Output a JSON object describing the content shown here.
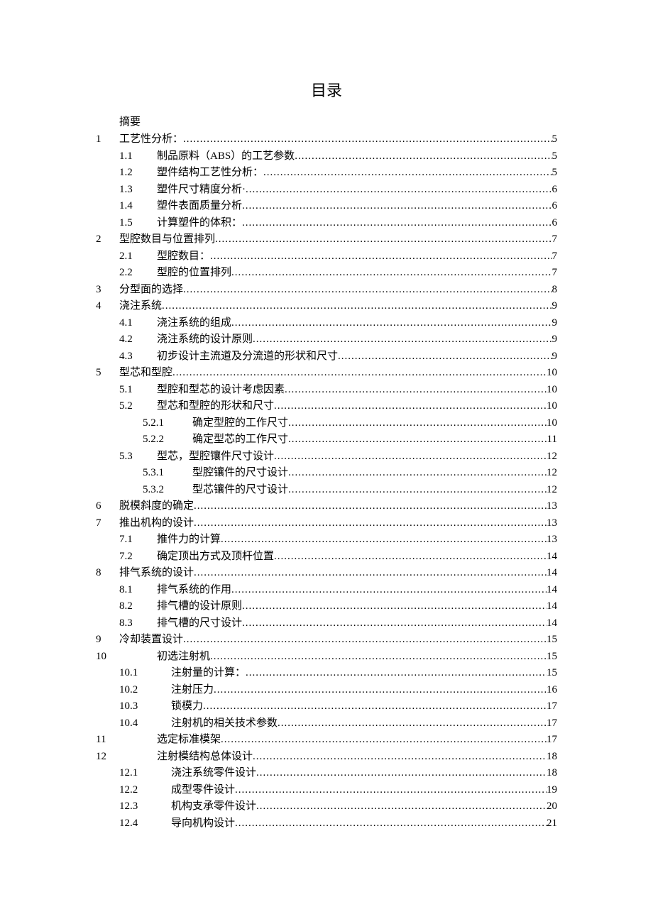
{
  "title": "目录",
  "abstract": "摘要",
  "entries": [
    {
      "level": 1,
      "num": "1",
      "text": "工艺性分析：",
      "page": "5"
    },
    {
      "level": 2,
      "num": "1.1",
      "text": "制品原料（ABS）的工艺参数",
      "page": "5"
    },
    {
      "level": 2,
      "num": "1.2",
      "text": "塑件结构工艺性分析：",
      "page": "5"
    },
    {
      "level": 2,
      "num": "1.3",
      "text": "塑件尺寸精度分析·",
      "page": "6"
    },
    {
      "level": 2,
      "num": "1.4",
      "text": "塑件表面质量分析",
      "page": "6"
    },
    {
      "level": 2,
      "num": "1.5",
      "text": "计算塑件的体积：",
      "page": "6"
    },
    {
      "level": 1,
      "num": "2",
      "text": "型腔数目与位置排列",
      "page": "7"
    },
    {
      "level": 2,
      "num": "2.1",
      "text": "型腔数目：",
      "page": "7"
    },
    {
      "level": 2,
      "num": "2.2",
      "text": "型腔的位置排列",
      "page": "7"
    },
    {
      "level": 1,
      "num": "3",
      "text": "分型面的选择",
      "page": "8"
    },
    {
      "level": 1,
      "num": "4",
      "text": "浇注系统",
      "page": "9"
    },
    {
      "level": 2,
      "num": "4.1",
      "text": "浇注系统的组成",
      "page": "9"
    },
    {
      "level": 2,
      "num": "4.2",
      "text": "浇注系统的设计原则",
      "page": "9"
    },
    {
      "level": 2,
      "num": "4.3",
      "text": "初步设计主流道及分流道的形状和尺寸",
      "page": "9"
    },
    {
      "level": 1,
      "num": "5",
      "text": "型芯和型腔",
      "page": "10"
    },
    {
      "level": 2,
      "num": "5.1",
      "text": "型腔和型芯的设计考虑因素",
      "page": "10"
    },
    {
      "level": 2,
      "num": "5.2",
      "text": "型芯和型腔的形状和尺寸",
      "page": "10"
    },
    {
      "level": 3,
      "num": "5.2.1",
      "text": "确定型腔的工作尺寸",
      "page": "10"
    },
    {
      "level": 3,
      "num": "5.2.2",
      "text": "确定型芯的工作尺寸",
      "page": "11"
    },
    {
      "level": 2,
      "num": "5.3",
      "text": "型芯，型腔镶件尺寸设计",
      "page": "12"
    },
    {
      "level": 3,
      "num": "5.3.1",
      "text": "型腔镶件的尺寸设计",
      "page": "12"
    },
    {
      "level": 3,
      "num": "5.3.2",
      "text": "型芯镶件的尺寸设计",
      "page": "12"
    },
    {
      "level": 1,
      "num": "6",
      "text": "脱模斜度的确定",
      "page": "13"
    },
    {
      "level": 1,
      "num": "7",
      "text": "推出机构的设计",
      "page": "13"
    },
    {
      "level": 2,
      "num": "7.1",
      "text": "推件力的计算",
      "page": "13"
    },
    {
      "level": 2,
      "num": "7.2",
      "text": "确定顶出方式及顶杆位置",
      "page": "14"
    },
    {
      "level": 1,
      "num": "8",
      "text": "排气系统的设计",
      "page": "14"
    },
    {
      "level": 2,
      "num": "8.1",
      "text": "排气系统的作用",
      "page": "14"
    },
    {
      "level": 2,
      "num": "8.2",
      "text": "排气槽的设计原则",
      "page": "14"
    },
    {
      "level": 2,
      "num": "8.3",
      "text": "排气槽的尺寸设计",
      "page": "14"
    },
    {
      "level": 1,
      "num": "9",
      "text": "冷却装置设计",
      "page": "15"
    },
    {
      "level": 1,
      "num": "10",
      "text": "初选注射机",
      "page": "15",
      "wide": true
    },
    {
      "level": 2,
      "num": "10.1",
      "text": "注射量的计算：",
      "page": "15",
      "wide": true
    },
    {
      "level": 2,
      "num": "10.2",
      "text": "注射压力",
      "page": "16",
      "wide": true
    },
    {
      "level": 2,
      "num": "10.3",
      "text": "锁模力",
      "page": "17",
      "wide": true
    },
    {
      "level": 2,
      "num": "10.4",
      "text": "注射机的相关技术参数",
      "page": "17",
      "wide": true
    },
    {
      "level": 1,
      "num": "11",
      "text": "选定标准模架",
      "page": "17",
      "wide": true
    },
    {
      "level": 1,
      "num": "12",
      "text": "注射模结构总体设计",
      "page": "18",
      "wide": true
    },
    {
      "level": 2,
      "num": "12.1",
      "text": "浇注系统零件设计",
      "page": "18",
      "wide": true
    },
    {
      "level": 2,
      "num": "12.2",
      "text": "成型零件设计",
      "page": "19",
      "wide": true
    },
    {
      "level": 2,
      "num": "12.3",
      "text": "机构支承零件设计",
      "page": "20",
      "wide": true
    },
    {
      "level": 2,
      "num": "12.4",
      "text": "导向机构设计",
      "page": "21",
      "wide": true
    }
  ]
}
